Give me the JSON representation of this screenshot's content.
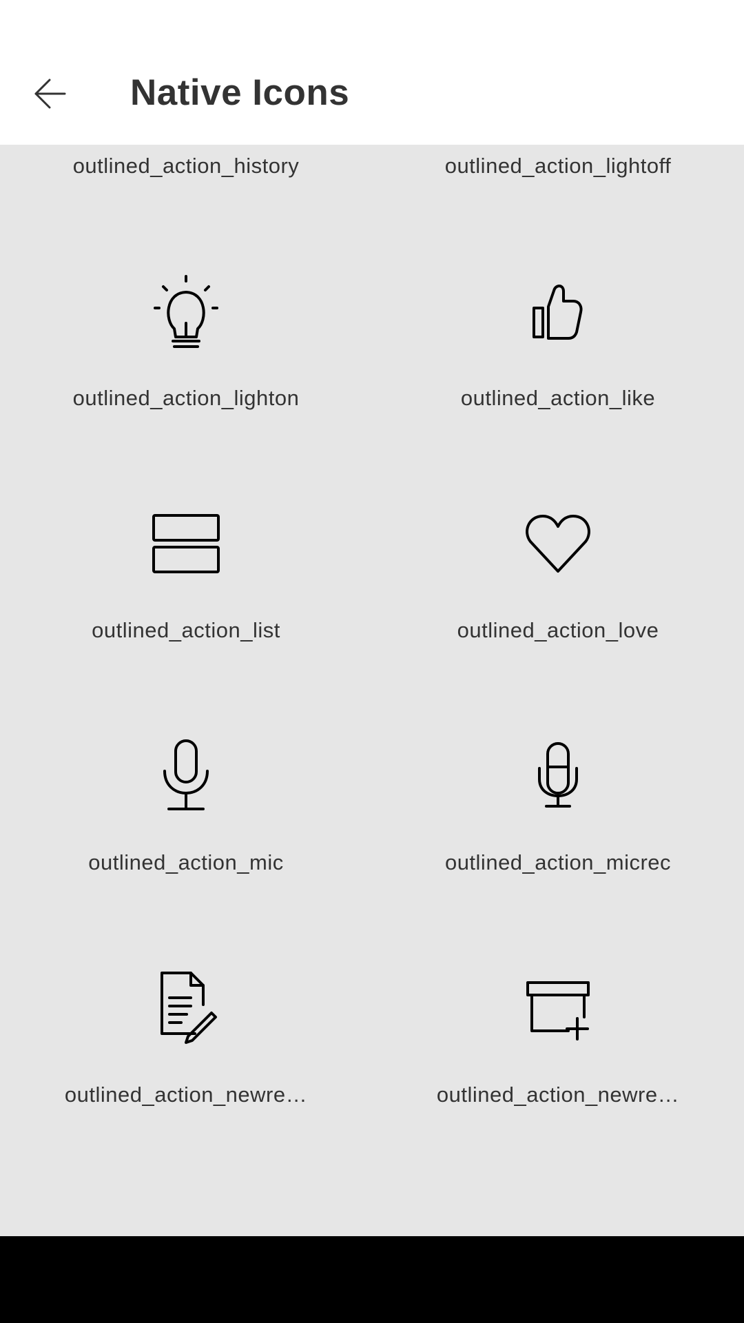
{
  "header": {
    "title": "Native Icons",
    "back_icon": "arrow-left-icon"
  },
  "icons": [
    {
      "label": "outlined_action_history",
      "icon": "history-icon"
    },
    {
      "label": "outlined_action_lightoff",
      "icon": "light-off-icon"
    },
    {
      "label": "outlined_action_lighton",
      "icon": "light-on-icon"
    },
    {
      "label": "outlined_action_like",
      "icon": "thumbs-up-icon"
    },
    {
      "label": "outlined_action_list",
      "icon": "list-icon"
    },
    {
      "label": "outlined_action_love",
      "icon": "heart-icon"
    },
    {
      "label": "outlined_action_mic",
      "icon": "microphone-icon"
    },
    {
      "label": "outlined_action_micrec",
      "icon": "microphone-recording-icon"
    },
    {
      "label": "outlined_action_newre…",
      "icon": "document-edit-icon"
    },
    {
      "label": "outlined_action_newre…",
      "icon": "box-add-icon"
    }
  ],
  "colors": {
    "background": "#e6e6e6",
    "header": "#ffffff",
    "text": "#333333",
    "navbar": "#000000"
  }
}
